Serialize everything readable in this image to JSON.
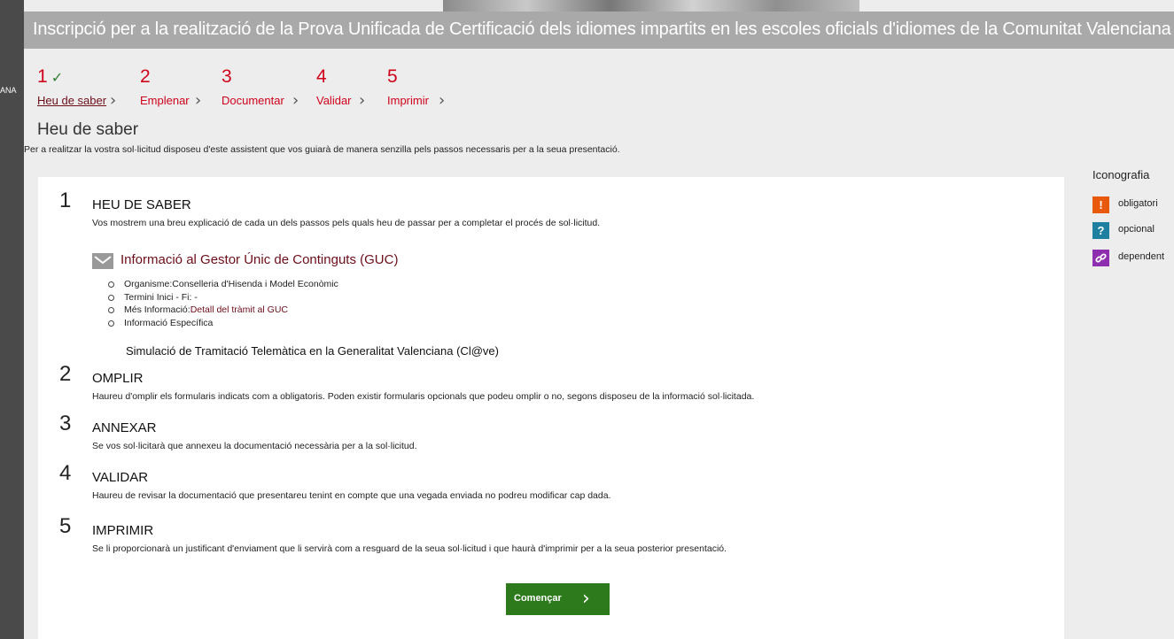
{
  "left_edge_text": "ANA",
  "header": {
    "title": "Inscripció per a la realització de la Prova Unificada de Certificació dels idiomes impartits en les escoles oficials d'idiomes de la Comunitat Valenciana"
  },
  "steps": [
    {
      "number": "1",
      "label": "Heu de saber",
      "completed": true,
      "check": "✓"
    },
    {
      "number": "2",
      "label": "Emplenar"
    },
    {
      "number": "3",
      "label": "Documentar"
    },
    {
      "number": "4",
      "label": "Validar"
    },
    {
      "number": "5",
      "label": "Imprimir"
    }
  ],
  "page": {
    "title": "Heu de saber",
    "intro": "Per a realitzar la vostra sol·licitud disposeu d'este assistent que vos guiarà de manera senzilla pels passos necessaris per a la seua presentació."
  },
  "sections": [
    {
      "number": "1",
      "heading": "HEU DE SABER",
      "text": "Vos mostrem una breu explicació de cada un dels passos pels quals heu de passar per a completar el procés de sol·licitud."
    },
    {
      "number": "2",
      "heading": "OMPLIR",
      "text": "Haureu d'omplir els formularis indicats com a obligatoris. Poden existir formularis opcionals que podeu omplir o no, segons disposeu de la informació sol·licitada."
    },
    {
      "number": "3",
      "heading": "ANNEXAR",
      "text": "Se vos sol·licitarà que annexeu la documentació necessària per a la sol·licitud."
    },
    {
      "number": "4",
      "heading": "VALIDAR",
      "text": "Haureu de revisar la documentació que presentareu tenint en compte que una vegada enviada no podreu modificar cap dada."
    },
    {
      "number": "5",
      "heading": "IMPRIMIR",
      "text": "Se li proporcionarà un justificant d'enviament que li servirà com a resguard de la seua sol·licitud i que haurà d'imprimir per a la seua posterior presentació."
    }
  ],
  "guc": {
    "title": "Informació al Gestor Únic de Continguts (GUC)",
    "organism_label": "Organisme:",
    "organism_value": "Conselleria d'Hisenda i Model Econòmic",
    "terms": "Termini Inici - Fi: -",
    "more_label": "Més Informació:",
    "more_link": "Detall del tràmit al GUC",
    "specific": "Informació Específica",
    "simulation": "Simulació de Tramitació Telemàtica en la Generalitat Valenciana (Cl@ve)"
  },
  "start_button": {
    "label": "Començar",
    "chevron": "›"
  },
  "iconography": {
    "title": "Iconografia",
    "items": [
      {
        "symbol": "!",
        "label": "obligatori",
        "color": "#e8590c"
      },
      {
        "symbol": "?",
        "label": "opcional",
        "color": "#1f7fa0"
      },
      {
        "symbol": "🔗",
        "label": "dependent",
        "color": "#8e2fb0"
      }
    ]
  },
  "colors": {
    "step_red": "#d0021b",
    "dark_red": "#6d0d19",
    "button_green": "#2d7a1c",
    "header_gray": "#a9a9a9"
  }
}
